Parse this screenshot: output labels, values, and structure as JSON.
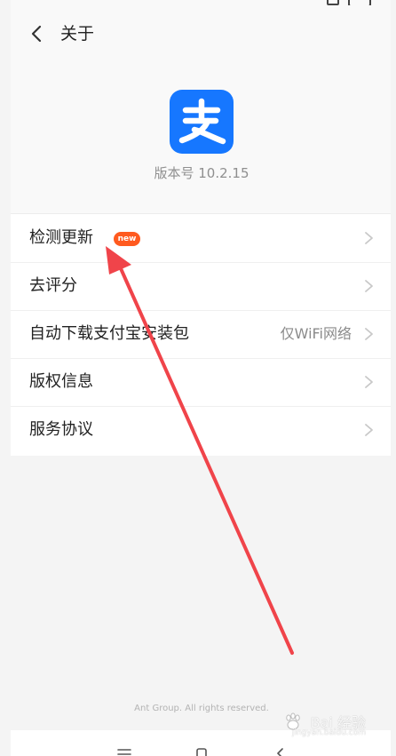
{
  "header": {
    "title": "关于"
  },
  "app": {
    "version": "版本号 10.2.15"
  },
  "menu": {
    "items": [
      {
        "label": "检测更新",
        "badge": "new"
      },
      {
        "label": "去评分"
      },
      {
        "label": "自动下载支付宝安装包",
        "value": "仅WiFi网络"
      },
      {
        "label": "版权信息"
      },
      {
        "label": "服务协议"
      }
    ]
  },
  "footer": {
    "copyright": "Ant Group. All rights reserved."
  },
  "watermark": {
    "main": "Bai 经验",
    "sub": "jingyan.baidu.com"
  },
  "colors": {
    "accent": "#1677ff",
    "badge": "#ff5a1f",
    "arrow": "#f0444a"
  }
}
